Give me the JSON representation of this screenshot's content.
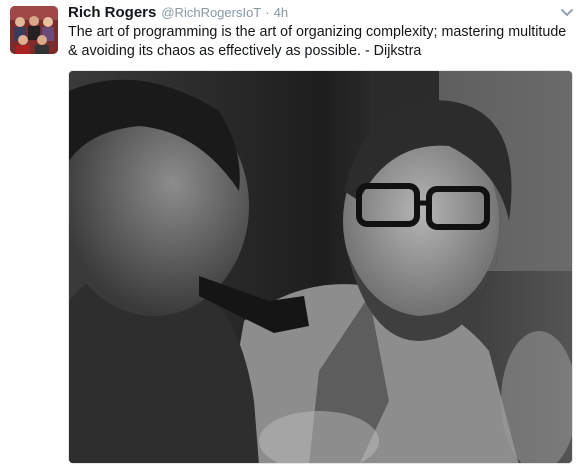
{
  "tweet": {
    "author_name": "Rich Rogers",
    "handle": "@RichRogersIoT",
    "separator": "·",
    "timestamp": "4h",
    "text": "The art of programming is the art of organizing complexity; mastering multitude & avoiding its chaos as effectively as possible. - Dijkstra",
    "avatar_icon": "avatar-group-photo",
    "menu_icon": "chevron-down-icon",
    "photo_icon": "bw-photo-two-men"
  },
  "colors": {
    "text": "#14171a",
    "secondary": "#8899a6",
    "border": "#e1e8ed"
  }
}
